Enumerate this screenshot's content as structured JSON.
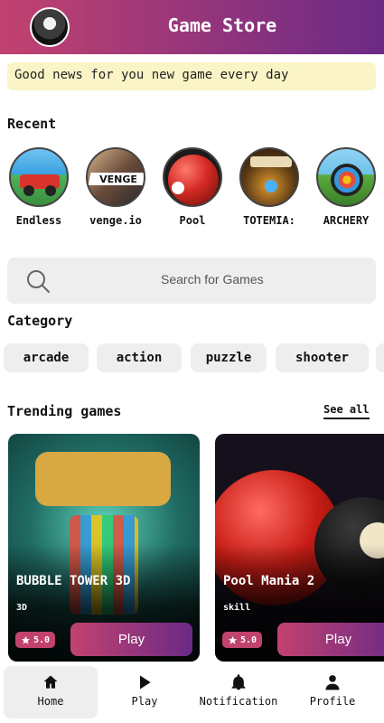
{
  "header": {
    "title": "Game Store"
  },
  "banner": {
    "text": "Good news for you new game every day"
  },
  "recent": {
    "title": "Recent",
    "items": [
      {
        "label": "Endless"
      },
      {
        "label": "venge.io"
      },
      {
        "label": "Pool"
      },
      {
        "label": "TOTEMIA:"
      },
      {
        "label": "ARCHERY"
      }
    ]
  },
  "search": {
    "placeholder": "Search for Games"
  },
  "category": {
    "title": "Category",
    "chips": [
      "arcade",
      "action",
      "puzzle",
      "shooter"
    ]
  },
  "trending": {
    "title": "Trending games",
    "see_all": "See all",
    "cards": [
      {
        "title": "BUBBLE TOWER 3D",
        "tag": "3D",
        "rating": "5.0",
        "play": "Play"
      },
      {
        "title": "Pool Mania 2",
        "tag": "skill",
        "rating": "5.0",
        "play": "Play"
      }
    ]
  },
  "nav": {
    "items": [
      {
        "label": "Home",
        "icon": "home-icon"
      },
      {
        "label": "Play",
        "icon": "play-icon"
      },
      {
        "label": "Notification",
        "icon": "bell-icon"
      },
      {
        "label": "Profile",
        "icon": "person-icon"
      }
    ]
  },
  "colors": {
    "accent_start": "#c2426f",
    "accent_end": "#6b2a86",
    "banner_bg": "#fbf4c6"
  }
}
